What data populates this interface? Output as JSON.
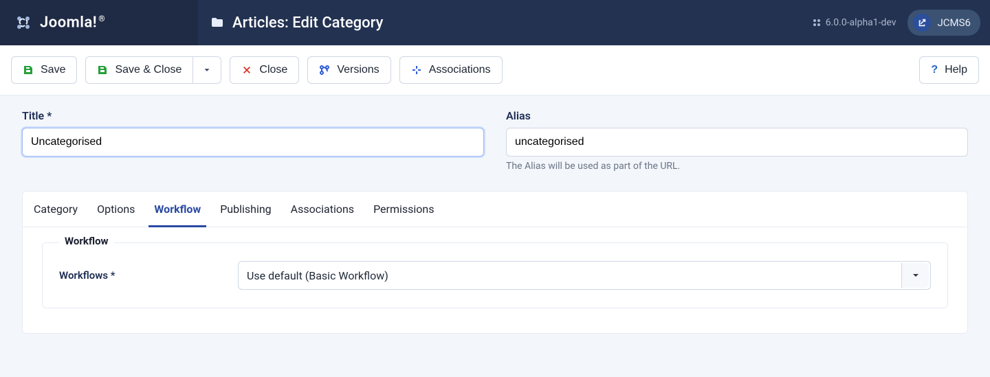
{
  "brand": {
    "name": "Joomla!",
    "registered": "®"
  },
  "page": {
    "title": "Articles: Edit Category"
  },
  "header": {
    "version": "6.0.0-alpha1-dev",
    "site_label": "JCMS6"
  },
  "toolbar": {
    "save": "Save",
    "save_close": "Save & Close",
    "close": "Close",
    "versions": "Versions",
    "associations": "Associations",
    "help": "Help"
  },
  "fields": {
    "title": {
      "label": "Title",
      "required": "*",
      "value": "Uncategorised"
    },
    "alias": {
      "label": "Alias",
      "value": "uncategorised",
      "hint": "The Alias will be used as part of the URL."
    }
  },
  "tabs": {
    "category": "Category",
    "options": "Options",
    "workflow": "Workflow",
    "publishing": "Publishing",
    "associations": "Associations",
    "permissions": "Permissions",
    "active": "workflow"
  },
  "workflow": {
    "legend": "Workflow",
    "label": "Workflows",
    "required": "*",
    "selected": "Use default (Basic Workflow)"
  }
}
